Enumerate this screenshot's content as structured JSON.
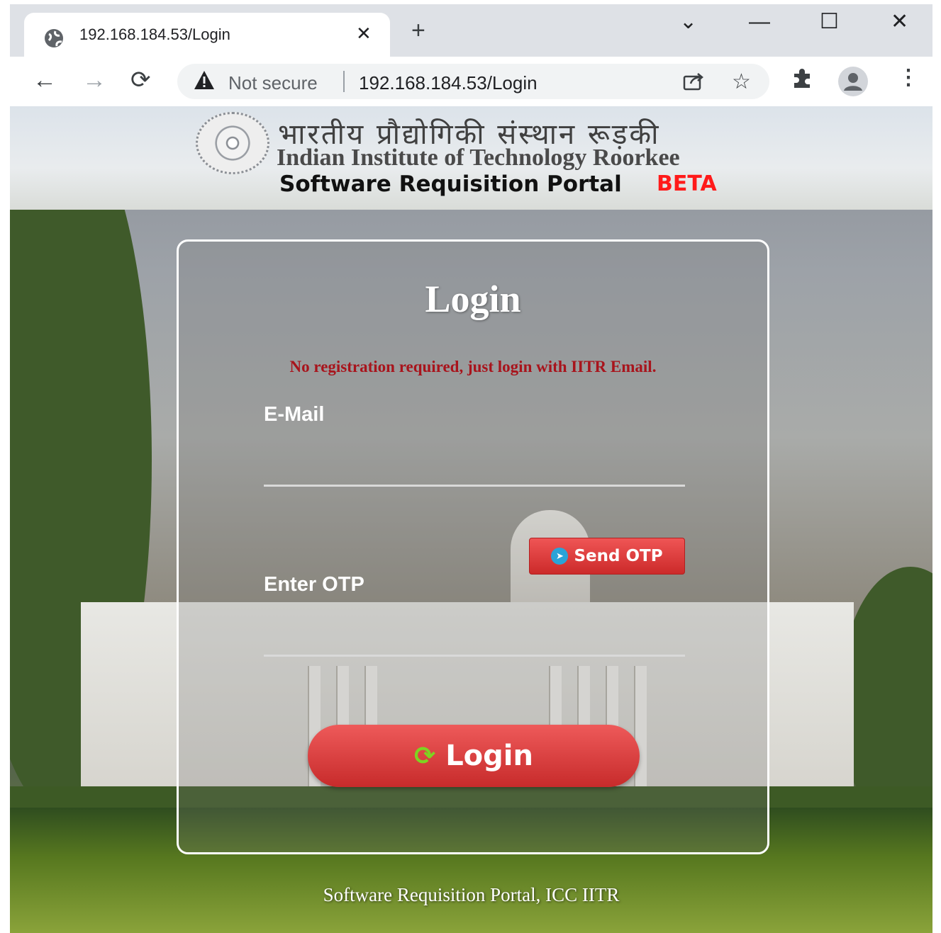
{
  "browser": {
    "tab_title": "192.168.184.53/Login",
    "tab_close": "✕",
    "new_tab": "+",
    "window_controls": {
      "tab_list": "⌄",
      "minimize": "—",
      "maximize": "☐",
      "close": "✕"
    },
    "nav": {
      "back": "←",
      "forward": "→",
      "reload": "⟳"
    },
    "security_label": "Not secure",
    "url": "192.168.184.53/Login",
    "star": "☆",
    "menu": "⋮"
  },
  "header": {
    "hindi_name": "भारतीय प्रौद्योगिकी संस्थान रूड़की",
    "institute_name": "Indian Institute of Technology Roorkee",
    "portal_name": "Software Requisition Portal",
    "badge": "BETA"
  },
  "login": {
    "title": "Login",
    "notice": "No registration required, just login with IITR Email.",
    "email_label": "E-Mail",
    "email_value": "",
    "send_otp_label": "Send OTP",
    "otp_label": "Enter OTP",
    "otp_value": "",
    "login_button_label": "Login"
  },
  "footer": {
    "text": "Software Requisition Portal, ICC IITR"
  },
  "colors": {
    "accent_red": "#d63333",
    "notice_red": "#a8141c",
    "beta_red": "#ff1a1a",
    "card_border": "#ffffff"
  }
}
